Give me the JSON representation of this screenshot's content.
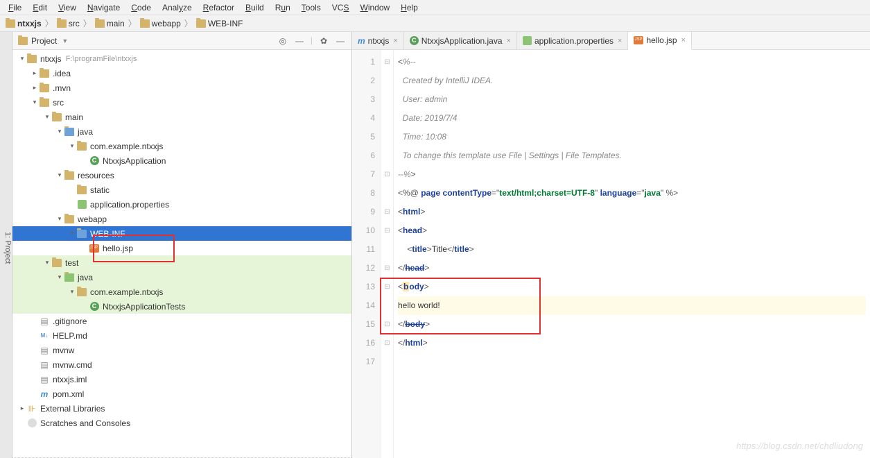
{
  "menu": [
    "File",
    "Edit",
    "View",
    "Navigate",
    "Code",
    "Analyze",
    "Refactor",
    "Build",
    "Run",
    "Tools",
    "VCS",
    "Window",
    "Help"
  ],
  "menu_underline_idx": [
    0,
    0,
    0,
    0,
    0,
    4,
    0,
    0,
    1,
    0,
    2,
    0,
    0
  ],
  "breadcrumb": [
    "ntxxjs",
    "src",
    "main",
    "webapp",
    "WEB-INF"
  ],
  "panel": {
    "title": "Project",
    "tools": [
      "target",
      "minus",
      "gear",
      "hide"
    ]
  },
  "tree_selected": "WEB-INF",
  "root": {
    "name": "ntxxjs",
    "path": "F:\\programFile\\ntxxjs"
  },
  "tree_rows": [
    {
      "d": 0,
      "arrow": "v",
      "kind": "folder",
      "label": "ntxxjs",
      "dim": "F:\\programFile\\ntxxjs"
    },
    {
      "d": 1,
      "arrow": ">",
      "kind": "folder",
      "label": ".idea"
    },
    {
      "d": 1,
      "arrow": ">",
      "kind": "folder",
      "label": ".mvn"
    },
    {
      "d": 1,
      "arrow": "v",
      "kind": "folder",
      "label": "src"
    },
    {
      "d": 2,
      "arrow": "v",
      "kind": "folder",
      "label": "main"
    },
    {
      "d": 3,
      "arrow": "v",
      "kind": "folder-blue",
      "label": "java"
    },
    {
      "d": 4,
      "arrow": "v",
      "kind": "folder",
      "label": "com.example.ntxxjs"
    },
    {
      "d": 5,
      "arrow": "",
      "kind": "class",
      "label": "NtxxjsApplication"
    },
    {
      "d": 3,
      "arrow": "v",
      "kind": "folder",
      "label": "resources"
    },
    {
      "d": 4,
      "arrow": "",
      "kind": "folder",
      "label": "static"
    },
    {
      "d": 4,
      "arrow": "",
      "kind": "prop",
      "label": "application.properties"
    },
    {
      "d": 3,
      "arrow": "v",
      "kind": "folder",
      "label": "webapp"
    },
    {
      "d": 4,
      "arrow": "v",
      "kind": "folder-blue",
      "label": "WEB-INF",
      "selected": true
    },
    {
      "d": 5,
      "arrow": "",
      "kind": "jsp",
      "label": "hello.jsp"
    },
    {
      "d": 2,
      "arrow": "v",
      "kind": "folder",
      "label": "test",
      "green": true
    },
    {
      "d": 3,
      "arrow": "v",
      "kind": "folder-green",
      "label": "java",
      "green": true
    },
    {
      "d": 4,
      "arrow": "v",
      "kind": "folder",
      "label": "com.example.ntxxjs",
      "green": true
    },
    {
      "d": 5,
      "arrow": "",
      "kind": "class",
      "label": "NtxxjsApplicationTests",
      "green": true
    },
    {
      "d": 1,
      "arrow": "",
      "kind": "file",
      "label": ".gitignore"
    },
    {
      "d": 1,
      "arrow": "",
      "kind": "md",
      "label": "HELP.md"
    },
    {
      "d": 1,
      "arrow": "",
      "kind": "file",
      "label": "mvnw"
    },
    {
      "d": 1,
      "arrow": "",
      "kind": "file",
      "label": "mvnw.cmd"
    },
    {
      "d": 1,
      "arrow": "",
      "kind": "file",
      "label": "ntxxjs.iml"
    },
    {
      "d": 1,
      "arrow": "",
      "kind": "m",
      "label": "pom.xml"
    },
    {
      "d": 0,
      "arrow": ">",
      "kind": "lib",
      "label": "External Libraries"
    },
    {
      "d": 0,
      "arrow": "",
      "kind": "scratch",
      "label": "Scratches and Consoles"
    }
  ],
  "tabs": [
    {
      "icon": "m",
      "label": "ntxxjs",
      "active": false
    },
    {
      "icon": "class",
      "label": "NtxxjsApplication.java",
      "active": false
    },
    {
      "icon": "prop",
      "label": "application.properties",
      "active": false
    },
    {
      "icon": "jsp",
      "label": "hello.jsp",
      "active": true
    }
  ],
  "code": {
    "lines": 17,
    "l1": "<%--",
    "l2": "  Created by IntelliJ IDEA.",
    "l3": "  User: admin",
    "l4": "  Date: 2019/7/4",
    "l5": "  Time: 10:08",
    "l6": "  To change this template use File | Settings | File Templates.",
    "l7": "--%>",
    "l8_pre": "<%@ ",
    "l8_page": "page",
    "l8_ct_attr": " contentType",
    "l8_eq": "=",
    "l8_q": "\"",
    "l8_ct_val": "text/html;charset=UTF-8",
    "l8_lang_attr": " language",
    "l8_lang_val": "java",
    "l8_end": " %>",
    "tag_html": "html",
    "tag_head": "head",
    "tag_title": "title",
    "title_text": "Title",
    "tag_body": "body",
    "body_text": "hello world!"
  },
  "watermark": "https://blog.csdn.net/chdliudong"
}
